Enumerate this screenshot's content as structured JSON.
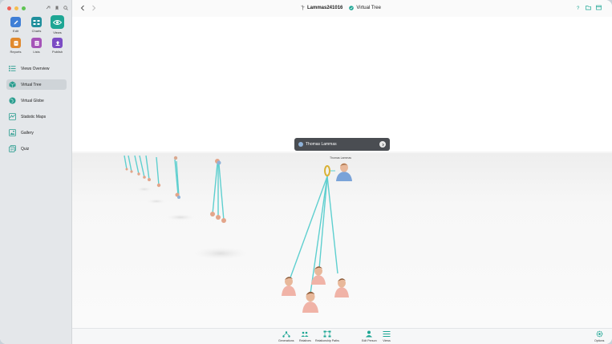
{
  "toolbar": {
    "tools": [
      {
        "label": "Edit",
        "color": "#3f7fd6",
        "icon": "pencil-icon"
      },
      {
        "label": "Charts",
        "color": "#1f8f9c",
        "icon": "charts-icon"
      },
      {
        "label": "Views",
        "color": "#1da694",
        "icon": "eye-icon",
        "active": true
      },
      {
        "label": "Reports",
        "color": "#e18a2e",
        "icon": "reports-icon"
      },
      {
        "label": "Lists",
        "color": "#a554b8",
        "icon": "lists-icon"
      },
      {
        "label": "Publish",
        "color": "#7b4cc4",
        "icon": "upload-icon"
      }
    ]
  },
  "sidebar": {
    "items": [
      {
        "label": "Views Overview",
        "icon": "grid-list-icon"
      },
      {
        "label": "Virtual Tree",
        "icon": "cube-icon",
        "active": true
      },
      {
        "label": "Virtual Globe",
        "icon": "globe-icon"
      },
      {
        "label": "Statistic Maps",
        "icon": "map-icon"
      },
      {
        "label": "Gallery",
        "icon": "gallery-icon"
      },
      {
        "label": "Quiz",
        "icon": "quiz-icon"
      }
    ]
  },
  "header": {
    "document": "Lammas241016",
    "view": "Virtual Tree"
  },
  "scene": {
    "tooltip_name": "Thomas Lammas",
    "person_label": "Thomas Lammas"
  },
  "bottombar": {
    "items": [
      "Generations",
      "Relatives",
      "Relationship Paths",
      "Edit Person",
      "Views",
      "Options"
    ]
  },
  "colors": {
    "accent": "#1da694",
    "line": "#5ecfcf"
  }
}
